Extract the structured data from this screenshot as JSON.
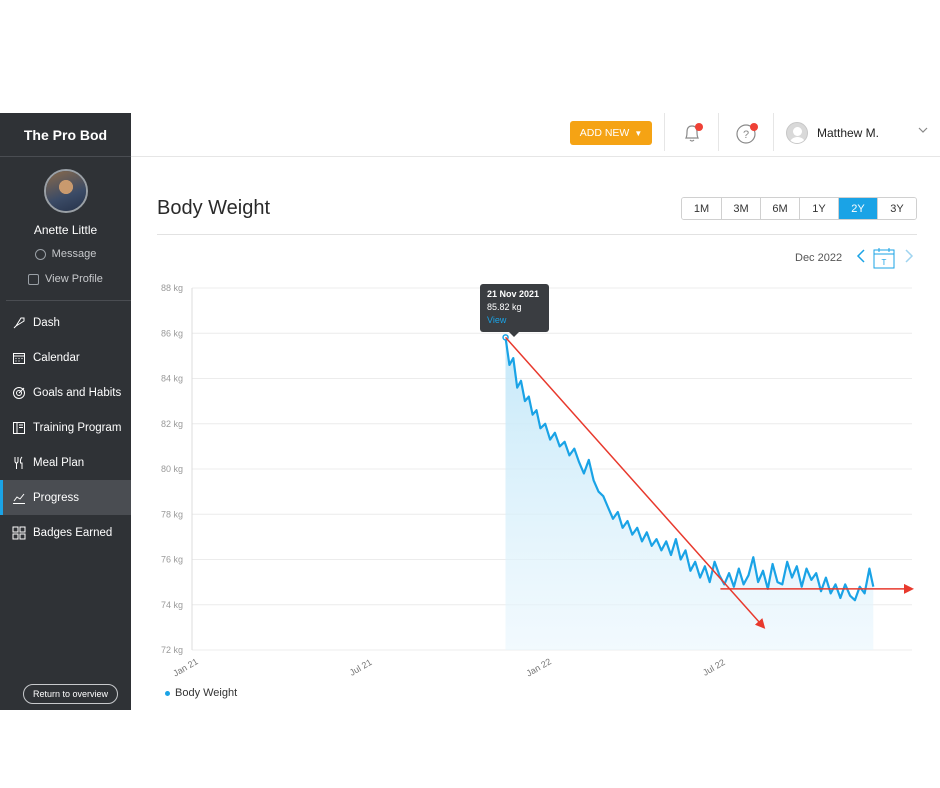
{
  "sidebar": {
    "brand": "The Pro Bod",
    "profile_name": "Anette Little",
    "message_label": "Message",
    "view_profile_label": "View Profile",
    "items": [
      {
        "label": "Dash",
        "icon": "rocket-icon"
      },
      {
        "label": "Calendar",
        "icon": "calendar-icon"
      },
      {
        "label": "Goals and Habits",
        "icon": "target-icon"
      },
      {
        "label": "Training Program",
        "icon": "book-icon"
      },
      {
        "label": "Meal Plan",
        "icon": "utensils-icon"
      },
      {
        "label": "Progress",
        "icon": "chart-icon",
        "active": true
      },
      {
        "label": "Badges Earned",
        "icon": "grid-icon"
      }
    ],
    "return_label": "Return to overview"
  },
  "topbar": {
    "add_new_label": "ADD NEW",
    "add_new_caret": "▼",
    "user_name": "Matthew M.",
    "accent": "#f5a314",
    "notification_color": "#ef4136"
  },
  "main": {
    "title": "Body Weight",
    "ranges": [
      "1M",
      "3M",
      "6M",
      "1Y",
      "2Y",
      "3Y"
    ],
    "active_range": "2Y",
    "date_label": "Dec 2022",
    "calendar_letter": "T",
    "legend_label": "Body Weight",
    "tooltip": {
      "date": "21 Nov 2021",
      "value": "85.82 kg",
      "link": "View"
    }
  },
  "chart_data": {
    "type": "area",
    "title": "Body Weight",
    "y_ticks": [
      "88 kg",
      "86 kg",
      "84 kg",
      "82 kg",
      "80 kg",
      "78 kg",
      "76 kg",
      "74 kg",
      "72 kg"
    ],
    "x_ticks": [
      "Jan 21",
      "Jul 21",
      "Jan 22",
      "Jul 22"
    ],
    "ylim": [
      72,
      88
    ],
    "xlim": [
      "2021-01-01",
      "2023-01-15"
    ],
    "grid": true,
    "legend": "bottom-left",
    "series_color": "#1aa3e6",
    "series": [
      {
        "name": "Body Weight",
        "points": [
          [
            "2021-11-21",
            85.82
          ],
          [
            "2021-11-25",
            84.6
          ],
          [
            "2021-11-29",
            84.9
          ],
          [
            "2021-12-03",
            83.6
          ],
          [
            "2021-12-07",
            83.9
          ],
          [
            "2021-12-11",
            83.0
          ],
          [
            "2021-12-15",
            83.2
          ],
          [
            "2021-12-19",
            82.4
          ],
          [
            "2021-12-23",
            82.6
          ],
          [
            "2021-12-27",
            81.8
          ],
          [
            "2022-01-01",
            82.0
          ],
          [
            "2022-01-06",
            81.3
          ],
          [
            "2022-01-11",
            81.6
          ],
          [
            "2022-01-16",
            81.0
          ],
          [
            "2022-01-21",
            81.2
          ],
          [
            "2022-01-26",
            80.6
          ],
          [
            "2022-01-31",
            80.9
          ],
          [
            "2022-02-05",
            80.3
          ],
          [
            "2022-02-10",
            79.8
          ],
          [
            "2022-02-15",
            80.4
          ],
          [
            "2022-02-20",
            79.5
          ],
          [
            "2022-02-25",
            79.0
          ],
          [
            "2022-03-02",
            78.8
          ],
          [
            "2022-03-07",
            78.3
          ],
          [
            "2022-03-12",
            77.8
          ],
          [
            "2022-03-17",
            78.1
          ],
          [
            "2022-03-22",
            77.4
          ],
          [
            "2022-03-27",
            77.7
          ],
          [
            "2022-04-01",
            77.1
          ],
          [
            "2022-04-06",
            77.4
          ],
          [
            "2022-04-11",
            76.8
          ],
          [
            "2022-04-16",
            77.2
          ],
          [
            "2022-04-21",
            76.6
          ],
          [
            "2022-04-26",
            76.9
          ],
          [
            "2022-05-01",
            76.4
          ],
          [
            "2022-05-06",
            76.8
          ],
          [
            "2022-05-11",
            76.2
          ],
          [
            "2022-05-16",
            76.9
          ],
          [
            "2022-05-21",
            76.0
          ],
          [
            "2022-05-26",
            76.4
          ],
          [
            "2022-05-31",
            75.5
          ],
          [
            "2022-06-05",
            75.9
          ],
          [
            "2022-06-10",
            75.2
          ],
          [
            "2022-06-15",
            75.7
          ],
          [
            "2022-06-20",
            75.0
          ],
          [
            "2022-06-25",
            75.9
          ],
          [
            "2022-06-30",
            75.3
          ],
          [
            "2022-07-05",
            74.9
          ],
          [
            "2022-07-10",
            75.4
          ],
          [
            "2022-07-15",
            74.8
          ],
          [
            "2022-07-20",
            75.6
          ],
          [
            "2022-07-25",
            74.9
          ],
          [
            "2022-07-30",
            75.3
          ],
          [
            "2022-08-04",
            76.1
          ],
          [
            "2022-08-09",
            75.0
          ],
          [
            "2022-08-14",
            75.5
          ],
          [
            "2022-08-19",
            74.7
          ],
          [
            "2022-08-24",
            75.8
          ],
          [
            "2022-08-29",
            75.0
          ],
          [
            "2022-09-03",
            74.9
          ],
          [
            "2022-09-08",
            75.9
          ],
          [
            "2022-09-13",
            75.2
          ],
          [
            "2022-09-18",
            75.7
          ],
          [
            "2022-09-23",
            74.8
          ],
          [
            "2022-09-28",
            75.6
          ],
          [
            "2022-10-03",
            75.1
          ],
          [
            "2022-10-08",
            75.4
          ],
          [
            "2022-10-13",
            74.6
          ],
          [
            "2022-10-18",
            75.2
          ],
          [
            "2022-10-23",
            74.5
          ],
          [
            "2022-10-28",
            74.9
          ],
          [
            "2022-11-02",
            74.3
          ],
          [
            "2022-11-07",
            74.9
          ],
          [
            "2022-11-12",
            74.4
          ],
          [
            "2022-11-17",
            74.2
          ],
          [
            "2022-11-22",
            74.8
          ],
          [
            "2022-11-27",
            74.5
          ],
          [
            "2022-12-02",
            75.6
          ],
          [
            "2022-12-06",
            74.8
          ]
        ]
      }
    ],
    "annotations": [
      {
        "type": "arrow",
        "color": "#e8392d",
        "from": [
          "2021-11-21",
          85.82
        ],
        "to": [
          "2022-08-15",
          73.0
        ]
      },
      {
        "type": "arrow",
        "color": "#e8392d",
        "from": [
          "2022-07-01",
          74.7
        ],
        "to": [
          "2023-01-15",
          74.7
        ]
      }
    ]
  }
}
